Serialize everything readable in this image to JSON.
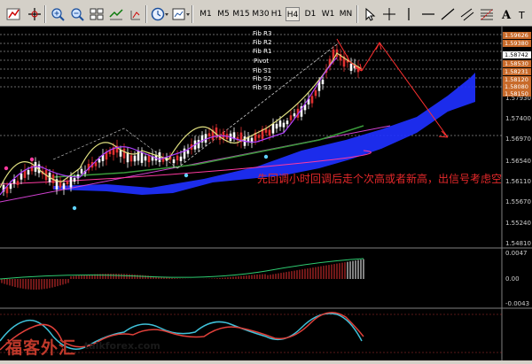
{
  "toolbar": {
    "timeframes": [
      "M1",
      "M5",
      "M15",
      "M30",
      "H1",
      "H4",
      "D1",
      "W1",
      "MN"
    ],
    "active_timeframe": "H4"
  },
  "main_chart": {
    "fib_levels": [
      "Fib R3",
      "Fib R2",
      "Fib R1",
      "Pivot",
      "Fib S1",
      "Fib S2",
      "Fib S3"
    ],
    "price_ticks": [
      "1.57930",
      "1.57400",
      "1.56970",
      "1.56540",
      "1.56110",
      "1.55670",
      "1.55240",
      "1.54810"
    ],
    "price_tags": [
      "1.59626",
      "1.59380",
      "1.58742",
      "1.58530",
      "1.58231",
      "1.58120",
      "1.58080",
      "1.58150"
    ]
  },
  "annotation": "先回调小时回调后走个次高或者新高，出信号考虑空",
  "macd_panel": {
    "ticks": [
      "0.0047",
      "0.00",
      "-0.0043"
    ]
  },
  "watermark": {
    "brand_cn": "福客外汇",
    "url": "talkforex.com"
  }
}
